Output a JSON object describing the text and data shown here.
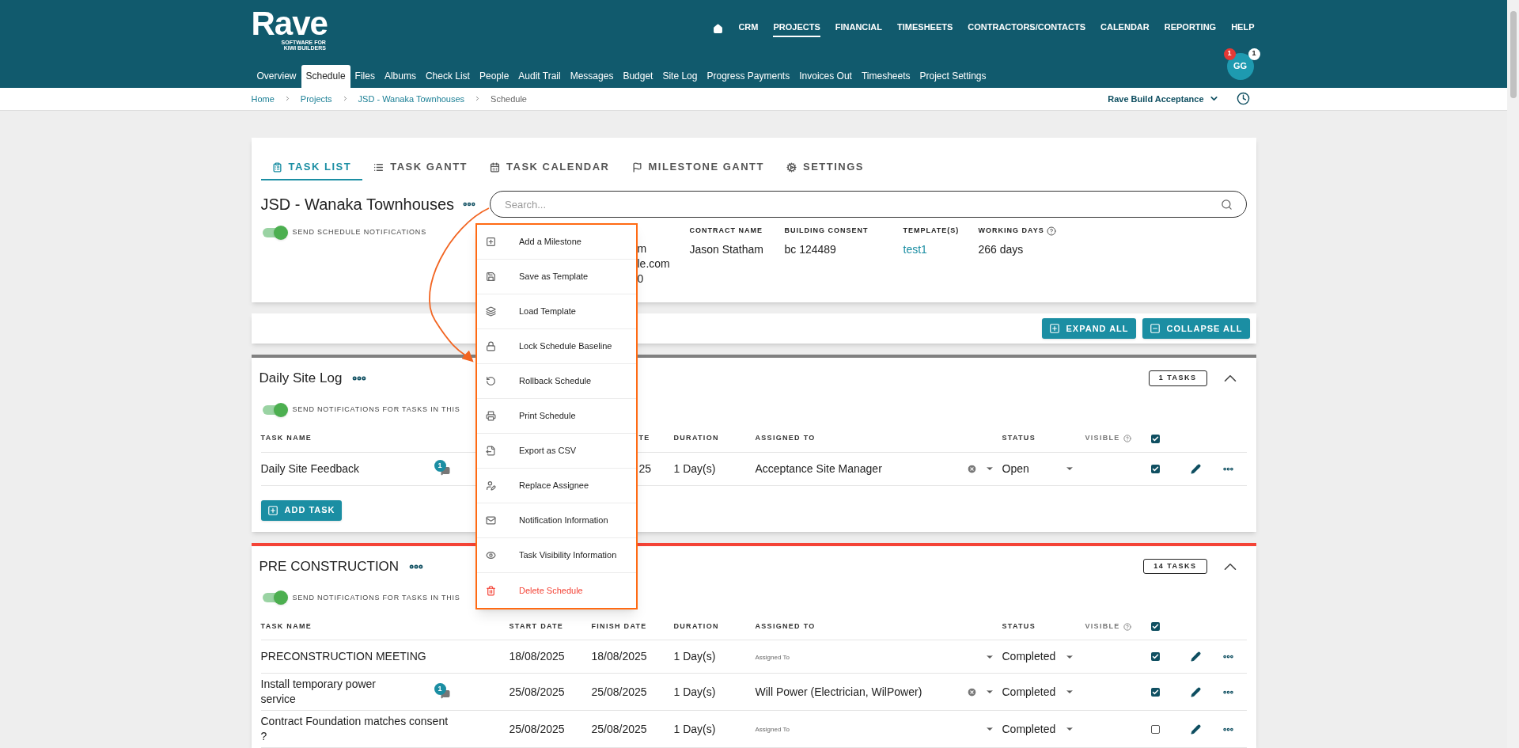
{
  "header": {
    "logo": {
      "name": "Rave",
      "tagline": [
        "SOFTWARE FOR",
        "KIWI BUILDERS"
      ]
    },
    "nav": [
      {
        "label": "CRM",
        "selected": false
      },
      {
        "label": "PROJECTS",
        "selected": true
      },
      {
        "label": "FINANCIAL",
        "selected": false
      },
      {
        "label": "TIMESHEETS",
        "selected": false
      },
      {
        "label": "CONTRACTORS/CONTACTS",
        "selected": false
      },
      {
        "label": "CALENDAR",
        "selected": false
      },
      {
        "label": "REPORTING",
        "selected": false
      },
      {
        "label": "HELP",
        "selected": false
      }
    ],
    "project_tabs": [
      {
        "label": "Overview",
        "selected": false
      },
      {
        "label": "Schedule",
        "selected": true
      },
      {
        "label": "Files",
        "selected": false
      },
      {
        "label": "Albums",
        "selected": false
      },
      {
        "label": "Check List",
        "selected": false
      },
      {
        "label": "People",
        "selected": false
      },
      {
        "label": "Audit Trail",
        "selected": false
      },
      {
        "label": "Messages",
        "selected": false
      },
      {
        "label": "Budget",
        "selected": false
      },
      {
        "label": "Site Log",
        "selected": false
      },
      {
        "label": "Progress Payments",
        "selected": false
      },
      {
        "label": "Invoices Out",
        "selected": false
      },
      {
        "label": "Timesheets",
        "selected": false
      },
      {
        "label": "Project Settings",
        "selected": false
      }
    ],
    "user": {
      "initials": "GG",
      "badges": [
        {
          "count": "1",
          "color": "#e53935"
        },
        {
          "count": "1",
          "color": "#ffffff"
        }
      ]
    }
  },
  "breadcrumb": {
    "items": [
      {
        "label": "Home",
        "current": false
      },
      {
        "label": "Projects",
        "current": false
      },
      {
        "label": "JSD - Wanaka Townhouses",
        "current": false
      },
      {
        "label": "Schedule",
        "current": true
      }
    ],
    "account": "Rave Build Acceptance"
  },
  "schedule": {
    "tabs": [
      {
        "label": "TASK LIST",
        "selected": true
      },
      {
        "label": "TASK GANTT",
        "selected": false
      },
      {
        "label": "TASK CALENDAR",
        "selected": false
      },
      {
        "label": "MILESTONE GANTT",
        "selected": false
      },
      {
        "label": "SETTINGS",
        "selected": false
      }
    ],
    "title": "JSD - Wanaka Townhouses",
    "search": {
      "placeholder": "Search..."
    },
    "notifications": {
      "label": "SEND SCHEDULE NOTIFICATIONS",
      "on": true
    },
    "partial_values": [
      "m",
      "le.com",
      "0"
    ],
    "info": [
      {
        "label": "CONTRACT NAME",
        "value": "Jason Statham",
        "link": false,
        "help": false
      },
      {
        "label": "BUILDING CONSENT",
        "value": "bc 124489",
        "link": false,
        "help": false
      },
      {
        "label": "TEMPLATE(S)",
        "value": "test1",
        "link": true,
        "help": false
      },
      {
        "label": "WORKING DAYS",
        "value": "266 days",
        "link": false,
        "help": true
      }
    ]
  },
  "toolbar": [
    "EXPAND ALL",
    "COLLAPSE ALL"
  ],
  "menu": [
    {
      "label": "Add a Milestone",
      "kind": "normal"
    },
    {
      "label": "Save as Template",
      "kind": "normal"
    },
    {
      "label": "Load Template",
      "kind": "normal"
    },
    {
      "label": "Lock Schedule Baseline",
      "kind": "normal"
    },
    {
      "label": "Rollback Schedule",
      "kind": "normal"
    },
    {
      "label": "Print Schedule",
      "kind": "normal"
    },
    {
      "label": "Export as CSV",
      "kind": "normal"
    },
    {
      "label": "Replace Assignee",
      "kind": "normal"
    },
    {
      "label": "Notification Information",
      "kind": "normal"
    },
    {
      "label": "Task Visibility Information",
      "kind": "normal"
    },
    {
      "label": "Delete Schedule",
      "kind": "danger"
    }
  ],
  "groups": [
    {
      "title": "Daily Site Log",
      "color": "#808080",
      "tasks": "1 TASKS",
      "expanded": true,
      "notify": {
        "label": "SEND NOTIFICATIONS FOR TASKS IN THIS",
        "on": true
      },
      "columns": {
        "name": "TASK NAME",
        "finish": "TE",
        "duration": "DURATION",
        "assigned": "ASSIGNED TO",
        "status": "STATUS",
        "visible": "VISIBLE"
      },
      "visible_all": true,
      "rows": [
        {
          "name": "Daily Site Feedback",
          "comments": "1",
          "finish": "25",
          "duration": "1 Day(s)",
          "assignee": "Acceptance Site Manager",
          "status": "Open",
          "visible": true
        }
      ],
      "add_task": "ADD TASK"
    },
    {
      "title": "PRE CONSTRUCTION",
      "color": "#f44336",
      "tasks": "14 TASKS",
      "expanded": true,
      "notify": {
        "label": "SEND NOTIFICATIONS FOR TASKS IN THIS",
        "on": true
      },
      "columns": {
        "name": "TASK NAME",
        "start": "START DATE",
        "finish": "FINISH DATE",
        "duration": "DURATION",
        "assigned": "ASSIGNED TO",
        "status": "STATUS",
        "visible": "VISIBLE"
      },
      "visible_all": true,
      "rows": [
        {
          "name": "PRECONSTRUCTION MEETING",
          "start": "18/08/2025",
          "finish": "18/08/2025",
          "duration": "1 Day(s)",
          "assignee_placeholder": "Assigned To",
          "status": "Completed",
          "visible": true
        },
        {
          "name": "Install temporary power service",
          "comments": "1",
          "start": "25/08/2025",
          "finish": "25/08/2025",
          "duration": "1 Day(s)",
          "assignee": "Will Power (Electrician, WilPower)",
          "status": "Completed",
          "visible": true
        },
        {
          "name": "Contract Foundation matches consent ?",
          "start": "25/08/2025",
          "finish": "25/08/2025",
          "duration": "1 Day(s)",
          "assignee_placeholder": "Assigned To",
          "status": "Completed",
          "visible": false
        }
      ]
    }
  ]
}
